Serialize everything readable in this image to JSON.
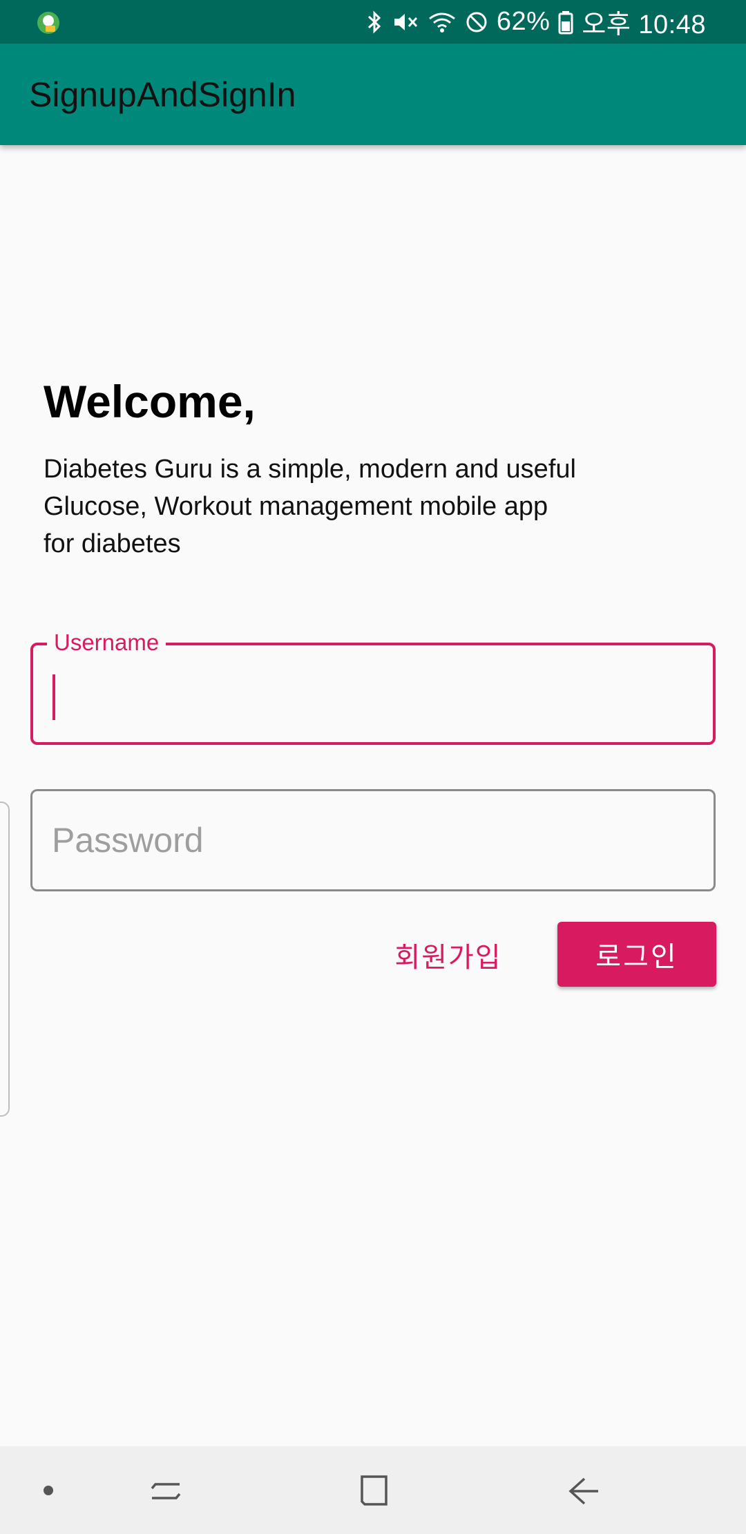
{
  "status_bar": {
    "battery": "62%",
    "time": "오후 10:48",
    "icons": [
      "bluetooth-icon",
      "mute-icon",
      "wifi-icon",
      "dnd-icon",
      "battery-icon"
    ]
  },
  "app_bar": {
    "title": "SignupAndSignIn"
  },
  "welcome": {
    "title": "Welcome,",
    "description_lines": [
      "Diabetes Guru is a simple, modern and useful",
      "Glucose, Workout management mobile app",
      "for diabetes"
    ]
  },
  "form": {
    "username_label": "Username",
    "username_value": "",
    "password_placeholder": "Password",
    "password_value": ""
  },
  "actions": {
    "signup_label": "회원가입",
    "login_label": "로그인"
  },
  "colors": {
    "status_bar": "#00695c",
    "app_bar": "#00897b",
    "accent": "#d81b60",
    "background": "#fafafa"
  },
  "nav_bar": {
    "items": [
      "dot-icon",
      "recent-apps-icon",
      "home-icon",
      "back-icon"
    ]
  }
}
